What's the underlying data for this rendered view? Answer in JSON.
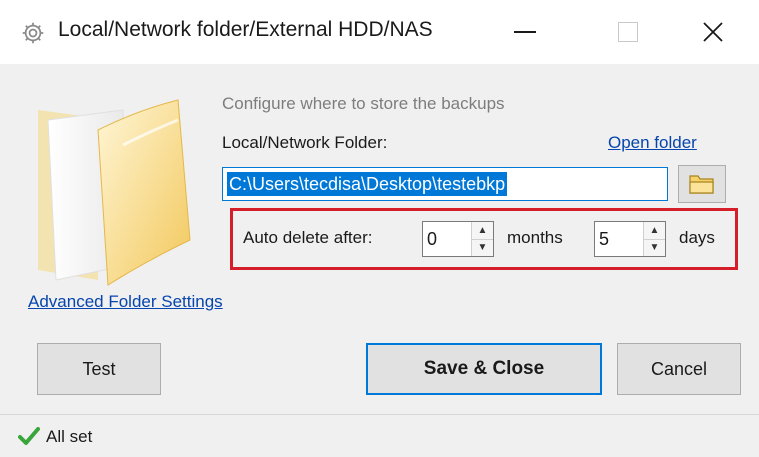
{
  "window": {
    "title": "Local/Network folder/External HDD/NAS",
    "icon": "gear-icon"
  },
  "content": {
    "description": "Configure where to store the backups",
    "folder_label": "Local/Network Folder:",
    "open_folder_link": "Open folder",
    "path_value": "C:\\Users\\tecdisa\\Desktop\\testebkp",
    "browse_icon": "folder-icon"
  },
  "auto_delete": {
    "label": "Auto delete after:",
    "months_value": "0",
    "months_label": "months",
    "days_value": "5",
    "days_label": "days"
  },
  "links": {
    "advanced": "Advanced Folder Settings"
  },
  "buttons": {
    "test": "Test",
    "save_close": "Save & Close",
    "cancel": "Cancel"
  },
  "status": {
    "text": "All set",
    "icon": "checkmark-icon"
  },
  "colors": {
    "accent": "#0078d7",
    "highlight": "#d41f2b",
    "link": "#0645ad",
    "status_ok": "#3aa53a"
  }
}
